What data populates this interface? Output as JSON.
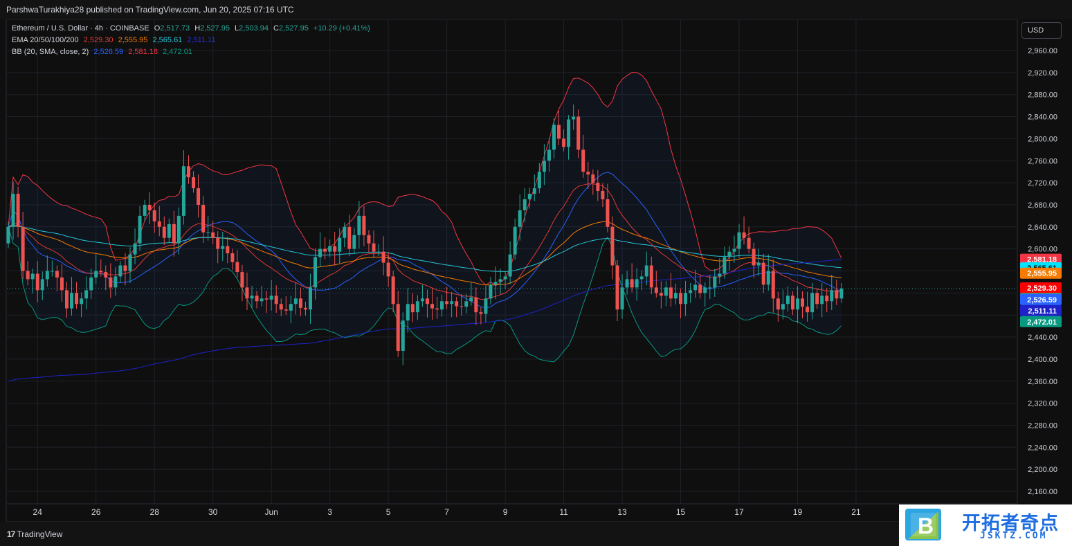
{
  "publisher_line": "ParshwaTurakhiya28 published on TradingView.com, Jun 20, 2025 07:16 UTC",
  "legend": {
    "symbol_info": "Ethereum / U.S. Dollar · 4h · COINBASE",
    "o_label": "O",
    "o_value": "2,517.73",
    "h_label": "H",
    "h_value": "2,527.95",
    "l_label": "L",
    "l_value": "2,503.94",
    "c_label": "C",
    "c_value": "2,527.95",
    "change": "+10.29 (+0.41%)",
    "ema_label": "EMA 20/50/100/200",
    "ema20": "2,529.30",
    "ema50": "2,555.95",
    "ema100": "2,565.61",
    "ema200": "2,511.11",
    "bb_label": "BB (20, SMA, close, 2)",
    "bb_basis": "2,526.59",
    "bb_upper": "2,581.18",
    "bb_lower": "2,472.01"
  },
  "currency_button": "USD",
  "footer_logo": "TradingView",
  "watermark": {
    "cn": "开拓者奇点",
    "en": "JSKTZ.COM",
    "letter": "B"
  },
  "colors": {
    "up": "#26a69a",
    "down": "#ef5350",
    "ema20": "#e53935",
    "ema50": "#f57c00",
    "ema100": "#26c6da",
    "ema200": "#1e22c8",
    "bb_basis": "#2962ff",
    "bb_upper": "#f23645",
    "bb_lower": "#089981"
  },
  "chart_data": {
    "type": "candlestick",
    "symbol": "Ethereum / U.S. Dollar",
    "timeframe": "4h",
    "exchange": "COINBASE",
    "y_ticks": [
      2960,
      2920,
      2880,
      2840,
      2800,
      2760,
      2720,
      2680,
      2640,
      2600,
      2560,
      2520,
      2480,
      2440,
      2400,
      2360,
      2320,
      2280,
      2240,
      2200,
      2160
    ],
    "y_tick_labels": [
      "2,960.00",
      "2,920.00",
      "2,880.00",
      "2,840.00",
      "2,800.00",
      "2,760.00",
      "2,720.00",
      "2,680.00",
      "2,640.00",
      "2,600.00",
      "2,560.00",
      "2,520.00",
      "2,480.00",
      "2,440.00",
      "2,400.00",
      "2,360.00",
      "2,320.00",
      "2,280.00",
      "2,240.00",
      "2,200.00",
      "2,160.00"
    ],
    "ylim": [
      2130,
      2990
    ],
    "x_tick_labels": [
      "24",
      "26",
      "28",
      "30",
      "Jun",
      "3",
      "5",
      "7",
      "9",
      "11",
      "13",
      "15",
      "17",
      "19",
      "21"
    ],
    "x_ticks_bar_index": [
      6,
      18,
      30,
      42,
      54,
      66,
      78,
      90,
      102,
      114,
      126,
      138,
      150,
      162,
      174
    ],
    "price_labels": [
      {
        "text": "2,581.18",
        "value": 2581.18,
        "color": "#f23645"
      },
      {
        "text": "2,565.61",
        "value": 2565.61,
        "color": "#00e5ff"
      },
      {
        "text": "2,555.95",
        "value": 2555.95,
        "color": "#f57c00"
      },
      {
        "text": "2,529.30",
        "value": 2529.3,
        "color": "#ff0000"
      },
      {
        "text": "43:43",
        "value": 2510,
        "color": "#26a69a"
      },
      {
        "text": "2,526.59",
        "value": 2508,
        "color": "#2962ff"
      },
      {
        "text": "2,511.11",
        "value": 2488,
        "color": "#1e22c8"
      },
      {
        "text": "2,472.01",
        "value": 2468,
        "color": "#089981"
      }
    ],
    "current_price": 2527.95,
    "closes": [
      2640,
      2700,
      2640,
      2560,
      2545,
      2555,
      2525,
      2545,
      2560,
      2560,
      2548,
      2525,
      2492,
      2520,
      2500,
      2510,
      2525,
      2548,
      2560,
      2558,
      2548,
      2530,
      2550,
      2570,
      2560,
      2590,
      2610,
      2660,
      2680,
      2670,
      2650,
      2640,
      2620,
      2645,
      2610,
      2660,
      2750,
      2730,
      2710,
      2680,
      2630,
      2630,
      2620,
      2600,
      2605,
      2592,
      2576,
      2558,
      2530,
      2510,
      2515,
      2505,
      2510,
      2508,
      2515,
      2500,
      2490,
      2488,
      2500,
      2510,
      2493,
      2490,
      2530,
      2585,
      2600,
      2595,
      2605,
      2595,
      2620,
      2640,
      2600,
      2625,
      2660,
      2625,
      2610,
      2595,
      2595,
      2575,
      2550,
      2500,
      2415,
      2470,
      2500,
      2485,
      2505,
      2510,
      2500,
      2492,
      2490,
      2505,
      2500,
      2505,
      2496,
      2495,
      2505,
      2512,
      2485,
      2482,
      2510,
      2535,
      2540,
      2545,
      2550,
      2590,
      2640,
      2670,
      2690,
      2700,
      2710,
      2740,
      2760,
      2780,
      2825,
      2800,
      2785,
      2835,
      2840,
      2780,
      2740,
      2735,
      2720,
      2705,
      2690,
      2640,
      2570,
      2490,
      2530,
      2545,
      2530,
      2545,
      2550,
      2570,
      2530,
      2520,
      2515,
      2530,
      2510,
      2520,
      2500,
      2520,
      2525,
      2535,
      2520,
      2530,
      2530,
      2550,
      2555,
      2585,
      2595,
      2600,
      2630,
      2620,
      2600,
      2570,
      2575,
      2535,
      2560,
      2510,
      2490,
      2500,
      2515,
      2490,
      2510,
      2495,
      2485,
      2520,
      2500,
      2515,
      2505,
      2525,
      2510,
      2528
    ]
  }
}
